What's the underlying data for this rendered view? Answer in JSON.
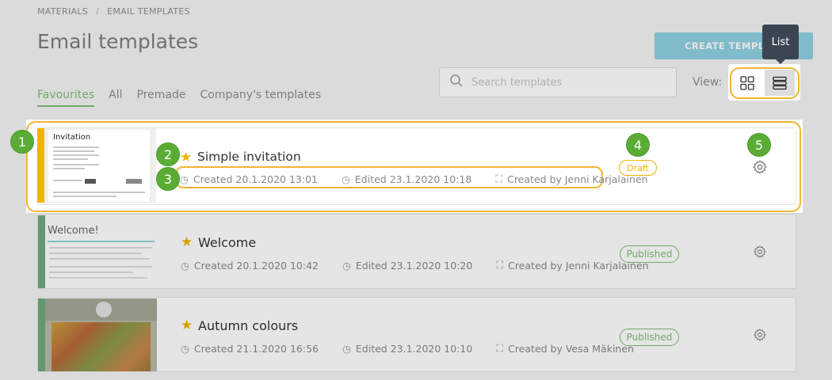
{
  "breadcrumb": {
    "items": [
      "MATERIALS",
      "EMAIL TEMPLATES"
    ],
    "separator": "/"
  },
  "page_title": "Email templates",
  "create_button": "CREATE TEMPLATE",
  "tabs": [
    {
      "label": "Favourites",
      "active": true
    },
    {
      "label": "All"
    },
    {
      "label": "Premade"
    },
    {
      "label": "Company's templates"
    }
  ],
  "search": {
    "placeholder": "Search templates"
  },
  "view": {
    "label": "View:",
    "tooltip": "List",
    "selected": "list"
  },
  "templates": [
    {
      "name": "Simple invitation",
      "favourite": true,
      "created": "Created 20.1.2020 13:01",
      "edited": "Edited 23.1.2020 10:18",
      "creator": "Created by Jenni Karjalainen",
      "status": "Draft",
      "thumb_title": "Invitation",
      "thumb_color": "#f0b400"
    },
    {
      "name": "Welcome",
      "favourite": true,
      "created": "Created 20.1.2020 10:42",
      "edited": "Edited 23.1.2020 10:20",
      "creator": "Created by Jenni Karjalainen",
      "status": "Published",
      "thumb_title": "Welcome!",
      "thumb_color": "#6fa97a"
    },
    {
      "name": "Autumn colours",
      "favourite": true,
      "created": "Created 21.1.2020 16:56",
      "edited": "Edited 23.1.2020 10:10",
      "creator": "Created by Vesa Mäkinen",
      "status": "Published",
      "thumb_color": "#6fa97a"
    }
  ],
  "markers": [
    "1",
    "2",
    "3",
    "4",
    "5"
  ],
  "colors": {
    "accent": "#7dbf72",
    "highlight": "#f1b533",
    "marker": "#5aac34",
    "star": "#f0b400",
    "button": "#8fd1e0"
  }
}
